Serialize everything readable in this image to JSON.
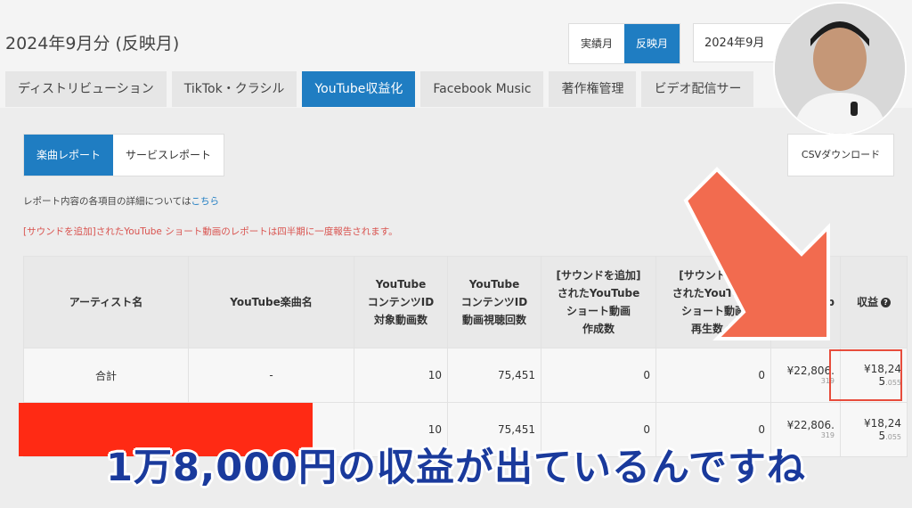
{
  "header": {
    "period_title": "2024年9月分 (反映月)",
    "month_toggle": [
      "実績月",
      "反映月"
    ],
    "month_select_value": "2024年9月"
  },
  "tabs": [
    "ディストリビューション",
    "TikTok・クラシル",
    "YouTube収益化",
    "Facebook Music",
    "著作権管理",
    "ビデオ配信サー"
  ],
  "report_toggle": [
    "楽曲レポート",
    "サービスレポート"
  ],
  "csv_label": "CSVダウンロード",
  "info": {
    "text": "レポート内容の各項目の詳細については",
    "link": "こちら"
  },
  "notice": "[サウンドを追加]されたYouTube ショート動画のレポートは四半期に一度報告されます。",
  "table": {
    "headers": [
      "アーティスト名",
      "YouTube楽曲名",
      "YouTube\nコンテンツID\n対象動画数",
      "YouTube\nコンテンツID\n動画視聴回数",
      "[サウンドを追加]\nされたYouTube\nショート動画\n作成数",
      "[サウンドを追\nされたYouTube\nショート動画\n再生数",
      "Tub",
      "収益"
    ],
    "rows": [
      {
        "artist": "合計",
        "song": "-",
        "target_videos": "10",
        "views": "75,451",
        "shorts_created": "0",
        "shorts_plays": "0",
        "col7_main": "¥22,806.",
        "col7_sub": "319",
        "revenue_main": "¥18,24",
        "revenue_sub_a": "5",
        "revenue_sub_b": ".055"
      },
      {
        "artist": "",
        "song": "",
        "target_videos": "10",
        "views": "75,451",
        "shorts_created": "0",
        "shorts_plays": "0",
        "col7_main": "¥22,806.",
        "col7_sub": "319",
        "revenue_main": "¥18,24",
        "revenue_sub_a": "5",
        "revenue_sub_b": ".055"
      }
    ]
  },
  "caption": "1万8,000円の収益が出ているんですね",
  "colors": {
    "accent": "#1f7dc2",
    "arrow": "#f26b4f",
    "caption": "#1a3a9c",
    "redaction": "#ff2a14"
  }
}
